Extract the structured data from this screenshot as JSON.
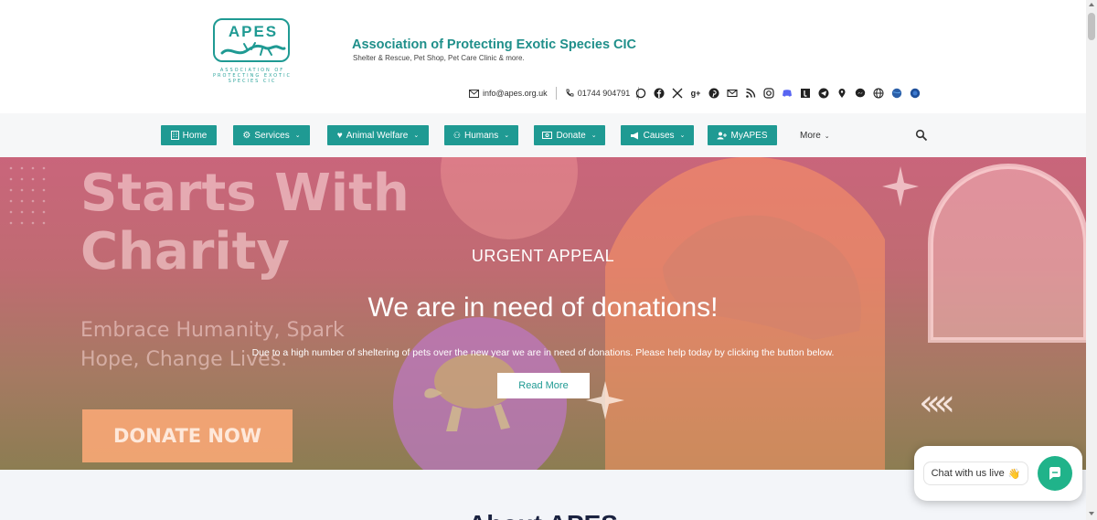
{
  "brand": {
    "logo_text": "APES",
    "logo_subtext": "ASSOCIATION OF PROTECTING EXOTIC SPECIES CIC",
    "site_title": "Association of Protecting Exotic Species CIC",
    "tagline": "Shelter & Rescue, Pet Shop, Pet Care Clinic & more.",
    "accent_color": "#1f9a93"
  },
  "contact": {
    "email": "info@apes.org.uk",
    "phone": "01744 904791"
  },
  "socials": [
    "whatsapp-icon",
    "facebook-icon",
    "x-icon",
    "google-plus-icon",
    "pinterest-icon",
    "email-icon",
    "rss-icon",
    "instagram-icon",
    "discord-icon",
    "tumblr-icon",
    "telegram-icon",
    "location-icon",
    "messenger-icon",
    "globe-icon",
    "web-icon",
    "web-alt-icon"
  ],
  "nav": {
    "items": [
      {
        "label": "Home",
        "icon": "building-icon",
        "dropdown": false
      },
      {
        "label": "Services",
        "icon": "gear-icon",
        "dropdown": true
      },
      {
        "label": "Animal Welfare",
        "icon": "heart-icon",
        "dropdown": true
      },
      {
        "label": "Humans",
        "icon": "people-icon",
        "dropdown": true
      },
      {
        "label": "Donate",
        "icon": "money-icon",
        "dropdown": true
      },
      {
        "label": "Causes",
        "icon": "megaphone-icon",
        "dropdown": true
      },
      {
        "label": "MyAPES",
        "icon": "user-plus-icon",
        "dropdown": false
      }
    ],
    "more_label": "More"
  },
  "hero": {
    "bg_line1": "Starts With",
    "bg_line2": "Charity",
    "bg_sub": "Embrace Humanity, Spark Hope, Change Lives.",
    "bg_donate": "DONATE NOW",
    "appeal_label": "URGENT APPEAL",
    "appeal_title": "We are in need of donations!",
    "appeal_text": "Due to a high number of sheltering of pets over the new year we are in need of donations. Please help today by clicking the button below.",
    "read_more": "Read More",
    "arrows": "‹‹‹‹"
  },
  "below": {
    "section_title": "About APES"
  },
  "chat": {
    "label": "Chat with us live",
    "emoji": "👋"
  }
}
